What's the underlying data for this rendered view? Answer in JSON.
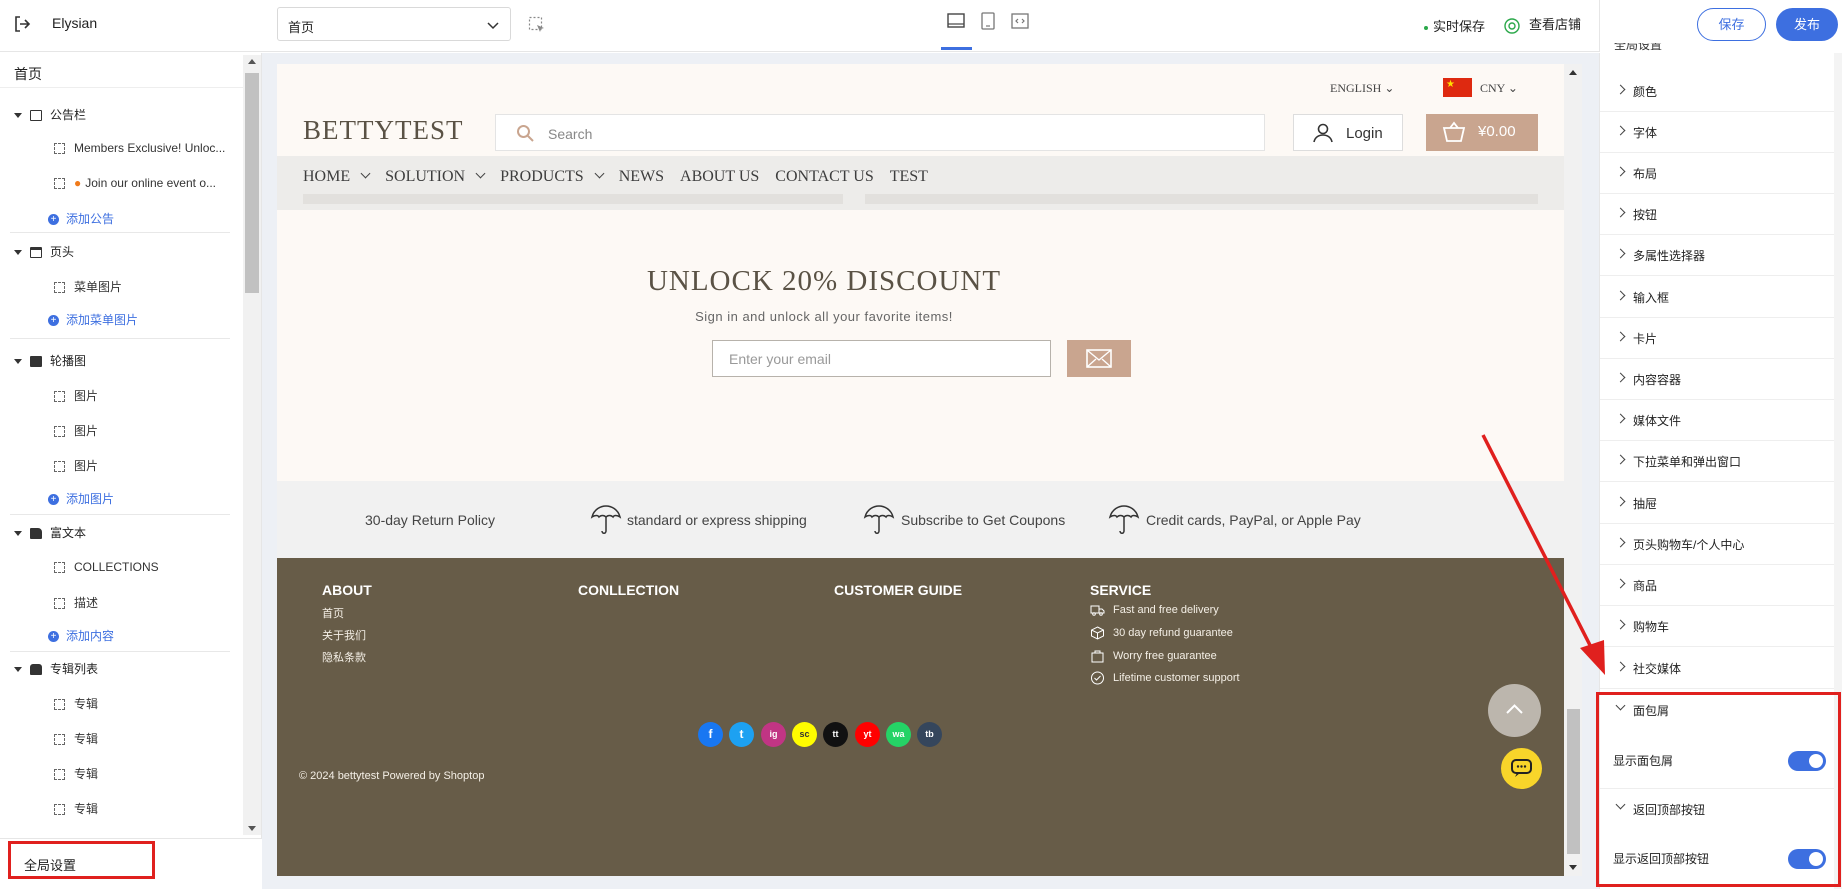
{
  "topbar": {
    "app_name": "Elysian",
    "page_select_value": "首页",
    "live_save": "实时保存",
    "view_store": "查看店铺",
    "save_label": "保存",
    "publish_label": "发布"
  },
  "left_panel": {
    "title": "首页",
    "groups": [
      {
        "label": "公告栏",
        "icon": "announcement-icon",
        "items": [
          "Members Exclusive! Unloc...",
          "Join our online event o..."
        ],
        "add": "添加公告"
      },
      {
        "label": "页头",
        "icon": "header-icon",
        "items": [
          "菜单图片"
        ],
        "add": "添加菜单图片"
      },
      {
        "label": "轮播图",
        "icon": "image-icon",
        "items": [
          "图片",
          "图片",
          "图片"
        ],
        "add": "添加图片"
      },
      {
        "label": "富文本",
        "icon": "document-icon",
        "items": [
          "COLLECTIONS",
          "描述"
        ],
        "add": "添加内容"
      },
      {
        "label": "专辑列表",
        "icon": "bag-icon",
        "items": [
          "专辑",
          "专辑",
          "专辑",
          "专辑"
        ]
      }
    ],
    "global_settings": "全局设置"
  },
  "store": {
    "language": "ENGLISH",
    "currency": "CNY",
    "logo": "BETTYTEST",
    "search_placeholder": "Search",
    "login": "Login",
    "cart_total": "¥0.00",
    "nav": [
      "HOME",
      "SOLUTION",
      "PRODUCTS",
      "NEWS",
      "ABOUT US",
      "CONTACT US",
      "TEST"
    ],
    "promo_title": "UNLOCK 20% DISCOUNT",
    "promo_subtitle": "Sign in and unlock all your favorite items!",
    "email_placeholder": "Enter your email",
    "features": [
      "30-day Return Policy",
      "standard or express shipping",
      "Subscribe to Get Coupons",
      "Credit cards, PayPal, or Apple Pay"
    ],
    "footer": {
      "about_title": "ABOUT",
      "about_links": [
        "首页",
        "关于我们",
        "隐私条款"
      ],
      "collection_title": "CONLLECTION",
      "guide_title": "CUSTOMER GUIDE",
      "service_title": "SERVICE",
      "service_items": [
        "Fast and free delivery",
        "30 day refund guarantee",
        "Worry free guarantee",
        "Lifetime customer support"
      ],
      "copyright": "© 2024 bettytest   Powered by Shoptop",
      "social": [
        "f",
        "t",
        "ig",
        "sc",
        "tt",
        "yt",
        "wa",
        "tb"
      ]
    }
  },
  "right_panel": {
    "top_label": "全局设置",
    "sections": [
      "颜色",
      "字体",
      "布局",
      "按钮",
      "多属性选择器",
      "输入框",
      "卡片",
      "内容容器",
      "媒体文件",
      "下拉菜单和弹出窗口",
      "抽屉",
      "页头购物车/个人中心",
      "商品",
      "购物车",
      "社交媒体"
    ],
    "breadcrumb_section": "面包屑",
    "breadcrumb_toggle_label": "显示面包屑",
    "backtop_section": "返回顶部按钮",
    "backtop_toggle_label": "显示返回顶部按钮"
  },
  "colors": {
    "accent": "#3d6fe0",
    "highlight": "#e0201e",
    "brand_tan": "#c9a58f",
    "footer_bg": "#675c48"
  }
}
